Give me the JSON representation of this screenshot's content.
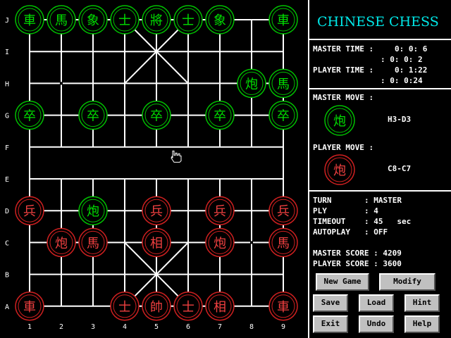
{
  "title": "CHINESE CHESS",
  "rank_labels": [
    "A",
    "B",
    "C",
    "D",
    "E",
    "F",
    "G",
    "H",
    "I",
    "J"
  ],
  "file_labels": [
    "1",
    "2",
    "3",
    "4",
    "5",
    "6",
    "7",
    "8",
    "9"
  ],
  "pieces": [
    {
      "file": 1,
      "rank": 9,
      "char": "車",
      "color": "green"
    },
    {
      "file": 2,
      "rank": 9,
      "char": "馬",
      "color": "green"
    },
    {
      "file": 3,
      "rank": 9,
      "char": "象",
      "color": "green"
    },
    {
      "file": 4,
      "rank": 9,
      "char": "士",
      "color": "green"
    },
    {
      "file": 5,
      "rank": 9,
      "char": "將",
      "color": "green"
    },
    {
      "file": 6,
      "rank": 9,
      "char": "士",
      "color": "green"
    },
    {
      "file": 7,
      "rank": 9,
      "char": "象",
      "color": "green"
    },
    {
      "file": 9,
      "rank": 9,
      "char": "車",
      "color": "green"
    },
    {
      "file": 8,
      "rank": 7,
      "char": "炮",
      "color": "green"
    },
    {
      "file": 9,
      "rank": 7,
      "char": "馬",
      "color": "green"
    },
    {
      "file": 1,
      "rank": 6,
      "char": "卒",
      "color": "green"
    },
    {
      "file": 3,
      "rank": 6,
      "char": "卒",
      "color": "green"
    },
    {
      "file": 5,
      "rank": 6,
      "char": "卒",
      "color": "green"
    },
    {
      "file": 7,
      "rank": 6,
      "char": "卒",
      "color": "green"
    },
    {
      "file": 9,
      "rank": 6,
      "char": "卒",
      "color": "green"
    },
    {
      "file": 3,
      "rank": 3,
      "char": "炮",
      "color": "green"
    },
    {
      "file": 1,
      "rank": 3,
      "char": "兵",
      "color": "red"
    },
    {
      "file": 5,
      "rank": 3,
      "char": "兵",
      "color": "red"
    },
    {
      "file": 7,
      "rank": 3,
      "char": "兵",
      "color": "red"
    },
    {
      "file": 9,
      "rank": 3,
      "char": "兵",
      "color": "red"
    },
    {
      "file": 2,
      "rank": 2,
      "char": "炮",
      "color": "red"
    },
    {
      "file": 3,
      "rank": 2,
      "char": "馬",
      "color": "red"
    },
    {
      "file": 5,
      "rank": 2,
      "char": "相",
      "color": "red"
    },
    {
      "file": 7,
      "rank": 2,
      "char": "炮",
      "color": "red"
    },
    {
      "file": 9,
      "rank": 2,
      "char": "馬",
      "color": "red"
    },
    {
      "file": 1,
      "rank": 0,
      "char": "車",
      "color": "red"
    },
    {
      "file": 4,
      "rank": 0,
      "char": "士",
      "color": "red"
    },
    {
      "file": 5,
      "rank": 0,
      "char": "帥",
      "color": "red"
    },
    {
      "file": 6,
      "rank": 0,
      "char": "士",
      "color": "red"
    },
    {
      "file": 7,
      "rank": 0,
      "char": "相",
      "color": "red"
    },
    {
      "file": 9,
      "rank": 0,
      "char": "車",
      "color": "red"
    }
  ],
  "crosshairs": [
    {
      "file": 2,
      "rank": 7
    },
    {
      "file": 8,
      "rank": 2
    }
  ],
  "pointer": {
    "file": 5.6,
    "rank": 4.7
  },
  "colors": {
    "green": "#00c000",
    "red": "#d02020",
    "green_text": "#00e000",
    "red_text": "#f04040",
    "title": "#00e8e8"
  },
  "timers": {
    "master_label": "MASTER TIME :",
    "master_total": "0: 0: 6",
    "master_move": ": 0: 0: 2",
    "player_label": "PLAYER TIME :",
    "player_total": "0: 1:22",
    "player_move": ": 0: 0:24"
  },
  "moves": {
    "master_label": "MASTER MOVE :",
    "master_char": "炮",
    "master_move": "H3-D3",
    "player_label": "PLAYER MOVE :",
    "player_char": "炮",
    "player_move": "C8-C7"
  },
  "status": {
    "turn_label": "TURN",
    "turn_value": ": MASTER",
    "ply_label": "PLY",
    "ply_value": ": 4",
    "timeout_label": "TIMEOUT",
    "timeout_value": ": 45   sec",
    "autoplay_label": "AUTOPLAY",
    "autoplay_value": ": OFF"
  },
  "scores": {
    "master": "MASTER SCORE : 4209",
    "player": "PLAYER SCORE : 3600"
  },
  "buttons": {
    "new_game": "New Game",
    "modify": "Modify",
    "save": "Save",
    "load": "Load",
    "hint": "Hint",
    "exit": "Exit",
    "undo": "Undo",
    "help": "Help"
  }
}
